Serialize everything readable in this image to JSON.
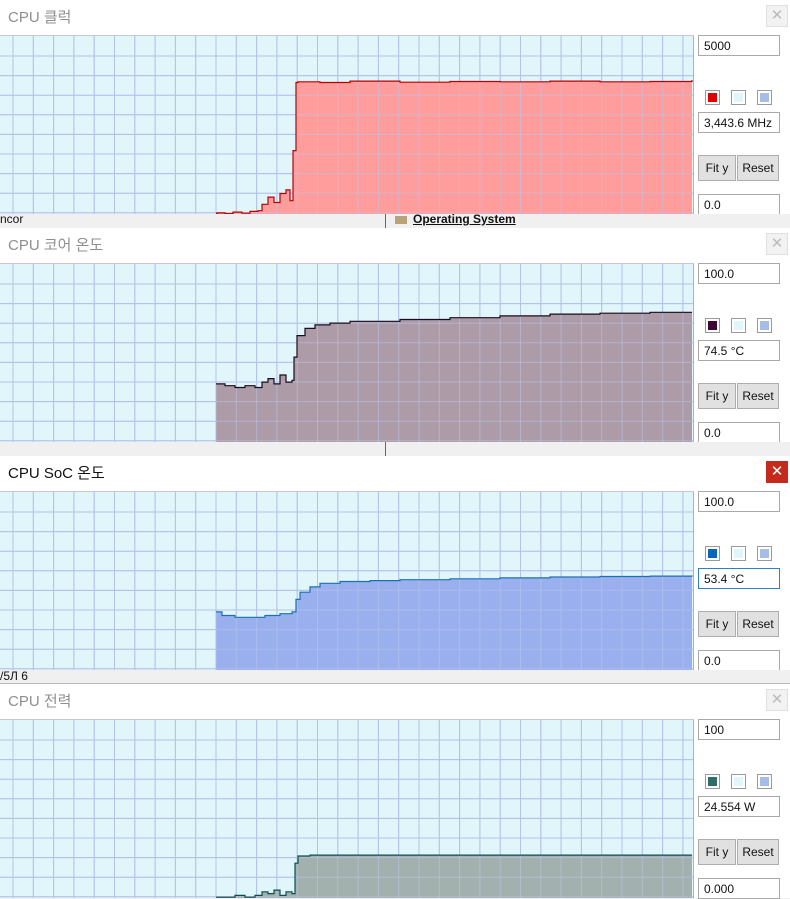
{
  "panels": [
    {
      "title": "CPU 클럭",
      "active": false,
      "max": "5000",
      "current": "3,443.6 MHz",
      "min": "0.0",
      "fit_label": "Fit y",
      "reset_label": "Reset",
      "colors": {
        "line": "#b80000",
        "fill": "#ff9c9c",
        "swatch": "#e10000"
      },
      "chart_data": {
        "type": "area",
        "ylim": [
          0,
          5000
        ],
        "x": [
          0,
          216,
          217,
          225,
          233,
          242,
          250,
          258,
          262,
          268,
          274,
          280,
          286,
          290,
          293,
          296,
          298,
          320,
          350,
          400,
          450,
          500,
          550,
          600,
          650,
          692
        ],
        "values": [
          null,
          40,
          60,
          40,
          80,
          50,
          100,
          120,
          300,
          500,
          350,
          600,
          700,
          400,
          1800,
          3700,
          3720,
          3700,
          3740,
          3710,
          3730,
          3720,
          3740,
          3720,
          3730,
          3770
        ]
      }
    },
    {
      "title": "CPU 코어 온도",
      "active": false,
      "max": "100.0",
      "current": "74.5 °C",
      "min": "0.0",
      "fit_label": "Fit y",
      "reset_label": "Reset",
      "colors": {
        "line": "#1d0a1d",
        "fill": "#ad9ba8",
        "swatch": "#3c0a32"
      },
      "chart_data": {
        "type": "area",
        "ylim": [
          0,
          100
        ],
        "x": [
          0,
          216,
          225,
          235,
          245,
          255,
          262,
          268,
          274,
          280,
          286,
          292,
          294,
          297,
          305,
          315,
          330,
          350,
          400,
          450,
          500,
          550,
          600,
          650,
          692
        ],
        "values": [
          null,
          33,
          32,
          31,
          32,
          31,
          34,
          36,
          33,
          38,
          34,
          35,
          48,
          60,
          64,
          66,
          67,
          68,
          69,
          70,
          71,
          72,
          72.5,
          73,
          73
        ]
      }
    },
    {
      "title": "CPU SoC 온도",
      "active": true,
      "max": "100.0",
      "current": "53.4 °C",
      "min": "0.0",
      "fit_label": "Fit y",
      "reset_label": "Reset",
      "colors": {
        "line": "#1e6fb4",
        "fill": "#9ab0ee",
        "swatch": "#0a66b8"
      },
      "chart_data": {
        "type": "area",
        "ylim": [
          0,
          100
        ],
        "x": [
          0,
          216,
          222,
          235,
          250,
          265,
          280,
          292,
          296,
          300,
          310,
          320,
          340,
          370,
          400,
          450,
          500,
          550,
          600,
          650,
          692
        ],
        "values": [
          null,
          33,
          31,
          30,
          30,
          31,
          32,
          33,
          40,
          44,
          47,
          49,
          50,
          50.5,
          51,
          51.5,
          52,
          52.5,
          52.8,
          53,
          53.4
        ]
      }
    },
    {
      "title": "CPU 전력",
      "active": false,
      "max": "100",
      "current": "24.554 W",
      "min": "0.000",
      "fit_label": "Fit y",
      "reset_label": "Reset",
      "colors": {
        "line": "#0c4e4e",
        "fill": "#a2b1ae",
        "swatch": "#2e6e66"
      },
      "chart_data": {
        "type": "area",
        "ylim": [
          0,
          100
        ],
        "x": [
          0,
          216,
          225,
          235,
          245,
          255,
          262,
          268,
          274,
          280,
          286,
          292,
          295,
          298,
          310,
          330,
          400,
          500,
          600,
          692
        ],
        "values": [
          null,
          1,
          1,
          2,
          1,
          2,
          4,
          3,
          5,
          2,
          4,
          3,
          20,
          24,
          24.5,
          24.5,
          24.5,
          24.5,
          24.5,
          24.5
        ]
      }
    }
  ],
  "background": {
    "operating_system_label": "Operating System",
    "partial_label_1": "ncor",
    "partial_label_2": "/5Л 6"
  }
}
